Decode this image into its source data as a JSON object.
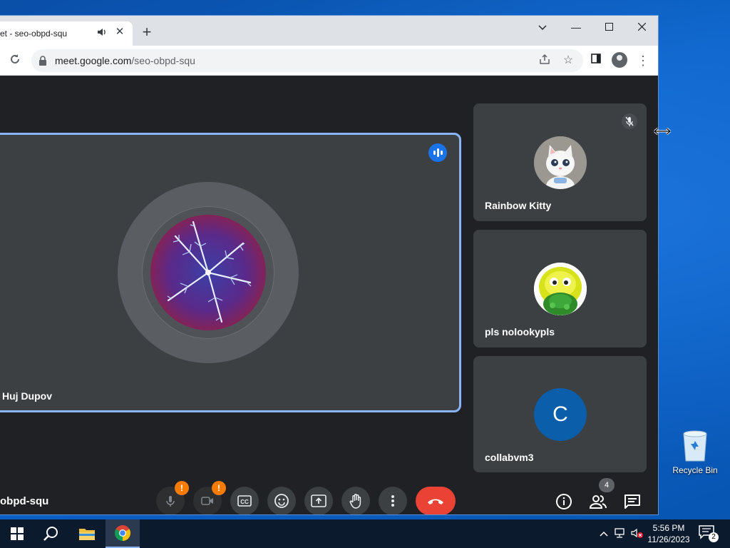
{
  "browser": {
    "tab_title": "et - seo-obpd-squ",
    "url_domain": "meet.google.com",
    "url_path": "/seo-obpd-squ"
  },
  "meet": {
    "main_participant": "Huj Dupov",
    "participants": [
      {
        "name": "Rainbow Kitty",
        "muted": true
      },
      {
        "name": "pls nolookypls"
      },
      {
        "name": "collabvm3",
        "initial": "C"
      }
    ],
    "meeting_code": "obpd-squ",
    "people_count": "4",
    "mic_warning": "!",
    "cam_warning": "!"
  },
  "desktop": {
    "recycle_bin_label": "Recycle Bin"
  },
  "taskbar": {
    "time": "5:56 PM",
    "date": "11/26/2023",
    "notification_count": "2"
  },
  "colors": {
    "meet_bg": "#202124",
    "tile_bg": "#3c4043",
    "active_border": "#8ab4f8",
    "end_call": "#ea4335",
    "warning": "#f57c00",
    "letter_avatar": "#0b5eaa"
  }
}
